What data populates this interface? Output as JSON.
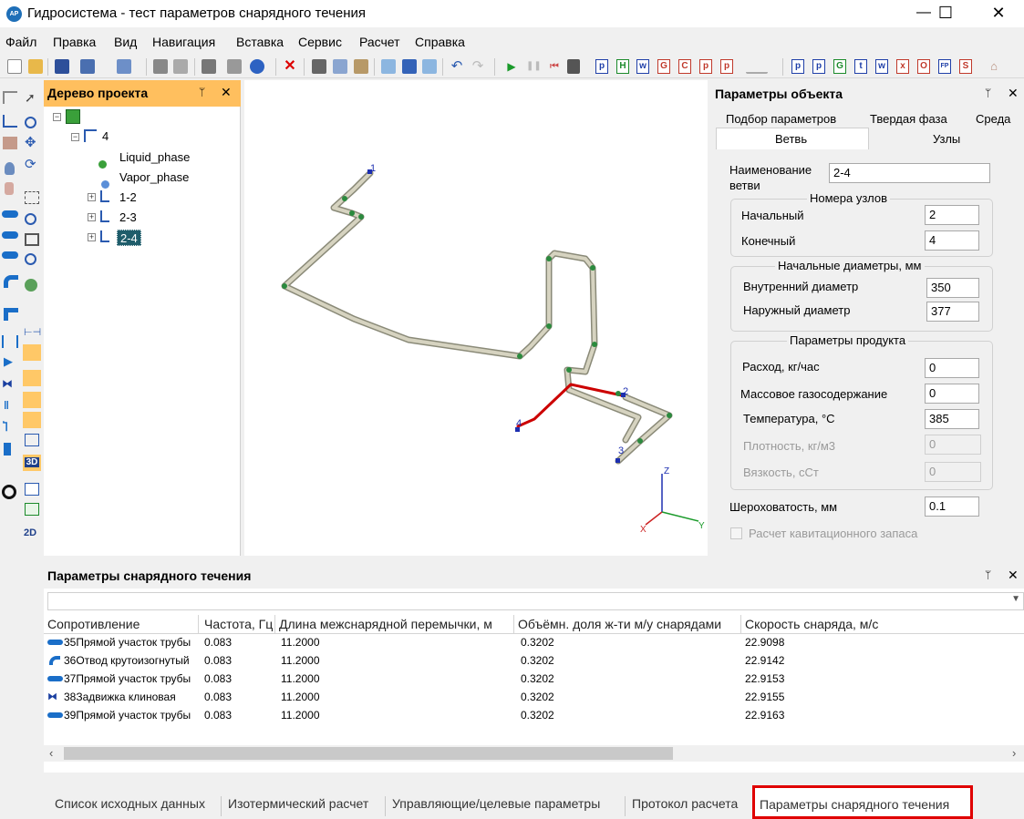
{
  "window": {
    "title": "Гидросистема - тест параметров снарядного течения",
    "app_icon": "AP",
    "minimize": "—",
    "maximize": "☐",
    "close": "✕"
  },
  "menu": [
    "Файл",
    "Правка",
    "Вид",
    "Навигация",
    "Вставка",
    "Сервис",
    "Расчет",
    "Справка"
  ],
  "toolbar": {
    "report_buttons": [
      "p",
      "H",
      "w",
      "G",
      "C",
      "p",
      "p"
    ],
    "report_buttons_2": [
      "p",
      "p",
      "G",
      "t",
      "w",
      "x",
      "O",
      "FP",
      "S"
    ]
  },
  "tree": {
    "title": "Дерево проекта",
    "pin": "ᛘ",
    "close": "✕",
    "root_label": "4",
    "children": [
      {
        "label": "Liquid_phase",
        "icon": "liquid-flask-icon"
      },
      {
        "label": "Vapor_phase",
        "icon": "vapor-flask-icon"
      },
      {
        "label": "1-2",
        "icon": "branch-icon"
      },
      {
        "label": "2-3",
        "icon": "branch-icon"
      },
      {
        "label": "2-4",
        "icon": "branch-icon",
        "selected": true
      }
    ]
  },
  "viewport": {
    "node_labels": [
      "1",
      "2",
      "3",
      "4"
    ],
    "axes": {
      "z": "Z",
      "y": "Y",
      "x": "X"
    },
    "colors": {
      "pipe": "#c8c4b0",
      "selected_pipe": "#d40000",
      "joint": "#2b8a3e",
      "node": "#1d2fb0"
    }
  },
  "params": {
    "title": "Параметры объекта",
    "pin": "ᛘ",
    "close": "✕",
    "tabs_row1": [
      "Подбор параметров",
      "Твердая фаза",
      "Среда"
    ],
    "tabs_row2": [
      "Ветвь",
      "Узлы"
    ],
    "branch_name_label": "Наименование ветви",
    "branch_name_value": "2-4",
    "nodes_group": "Номера узлов",
    "start_node_label": "Начальный",
    "start_node_value": "2",
    "end_node_label": "Конечный",
    "end_node_value": "4",
    "diam_group": "Начальные диаметры, мм",
    "inner_diam_label": "Внутренний диаметр",
    "inner_diam_value": "350",
    "outer_diam_label": "Наружный диаметр",
    "outer_diam_value": "377",
    "product_group": "Параметры продукта",
    "flow_label": "Расход, кг/час",
    "flow_value": "0",
    "gas_label": "Массовое газосодержание",
    "gas_value": "0",
    "temp_label": "Температура, °С",
    "temp_value": "385",
    "density_label": "Плотность, кг/м3",
    "density_value": "0",
    "viscosity_label": "Вязкость, сСт",
    "viscosity_value": "0",
    "roughness_label": "Шероховатость, мм",
    "roughness_value": "0.1",
    "cavitation_label": "Расчет кавитационного запаса"
  },
  "slug": {
    "title": "Параметры снарядного течения",
    "pin": "ᛘ",
    "close": "✕",
    "dropdown": "",
    "columns": [
      "Сопротивление",
      "Частота, Гц",
      "Длина межснарядной перемычки, м",
      "Объёмн. доля ж-ти м/у снарядами",
      "Скорость снаряда, м/с"
    ],
    "rows": [
      {
        "name": "35Прямой участок трубы",
        "icon": "straight-pipe-icon",
        "freq": "0.083",
        "length": "11.2000",
        "fraction": "0.3202",
        "speed": "22.9098"
      },
      {
        "name": "36Отвод крутоизогнутый",
        "icon": "elbow-icon",
        "freq": "0.083",
        "length": "11.2000",
        "fraction": "0.3202",
        "speed": "22.9142"
      },
      {
        "name": "37Прямой участок трубы",
        "icon": "straight-pipe-icon",
        "freq": "0.083",
        "length": "11.2000",
        "fraction": "0.3202",
        "speed": "22.9153"
      },
      {
        "name": "38Задвижка клиновая",
        "icon": "gate-valve-icon",
        "freq": "0.083",
        "length": "11.2000",
        "fraction": "0.3202",
        "speed": "22.9155"
      },
      {
        "name": "39Прямой участок трубы",
        "icon": "straight-pipe-icon",
        "freq": "0.083",
        "length": "11.2000",
        "fraction": "0.3202",
        "speed": "22.9163"
      }
    ]
  },
  "bottom_tabs": [
    "Список исходных данных",
    "Изотермический расчет",
    "Управляющие/целевые параметры",
    "Протокол расчета",
    "Параметры снарядного течения"
  ],
  "active_bottom_tab": "Параметры снарядного течения",
  "colors": {
    "tree_header": "#ffbf5e",
    "active_tab_border": "#e00000",
    "selection": "#1f5d6b"
  }
}
